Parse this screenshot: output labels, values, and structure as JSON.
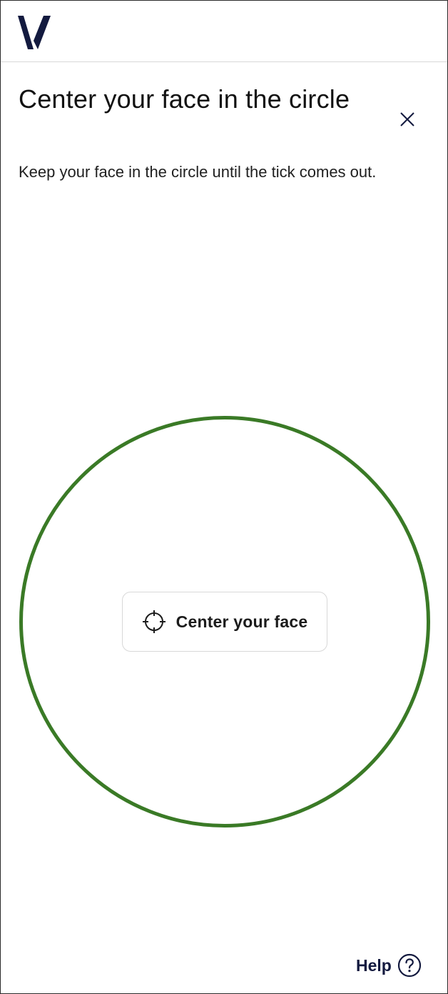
{
  "header": {
    "logo_icon": "brand-v-logo-icon",
    "brand_color": "#131a3f"
  },
  "content": {
    "title": "Center your face in the circle",
    "subtitle": "Keep your face in the circle until the tick comes out.",
    "close_icon": "close-icon"
  },
  "camera": {
    "ring_color": "#3a7a26",
    "status_icon": "crosshair-icon",
    "status_label": "Center your face"
  },
  "footer": {
    "help_label": "Help",
    "help_icon": "question-circle-icon"
  }
}
